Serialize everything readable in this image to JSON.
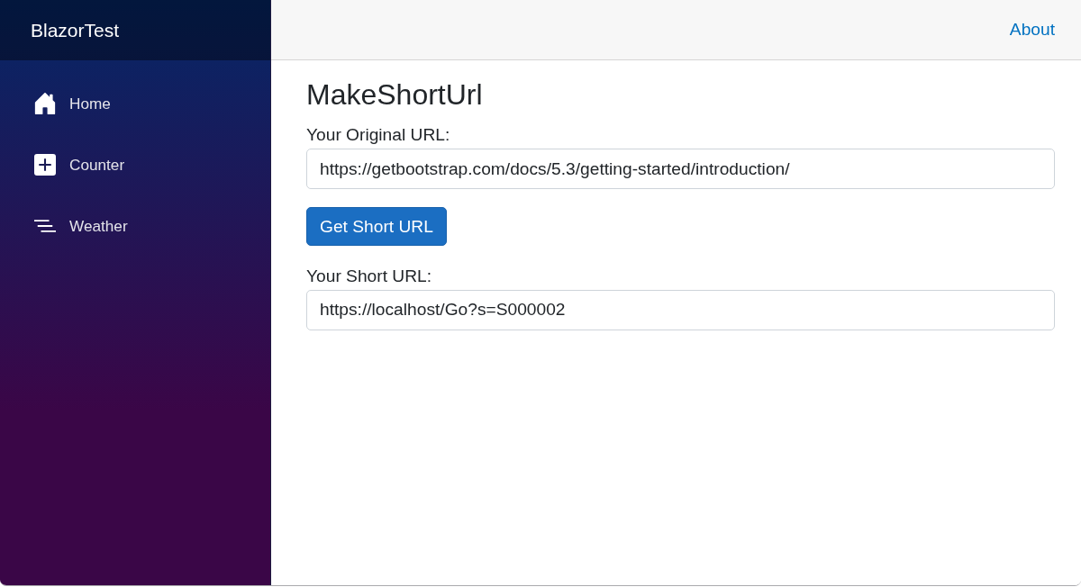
{
  "sidebar": {
    "brand": "BlazorTest",
    "items": [
      {
        "label": "Home",
        "kind": "home"
      },
      {
        "label": "Counter",
        "kind": "plus"
      },
      {
        "label": "Weather",
        "kind": "list"
      }
    ]
  },
  "top_bar": {
    "links": [
      "About"
    ]
  },
  "page": {
    "title": "MakeShortUrl",
    "form": [
      {
        "kind": "field",
        "label": "Your Original URL:",
        "value": "https://getbootstrap.com/docs/5.3/getting-started/introduction/"
      },
      {
        "kind": "button",
        "label": "Get Short URL"
      },
      {
        "kind": "field",
        "label": "Your Short URL:",
        "value": "https://localhost/Go?s=S000002"
      }
    ]
  }
}
